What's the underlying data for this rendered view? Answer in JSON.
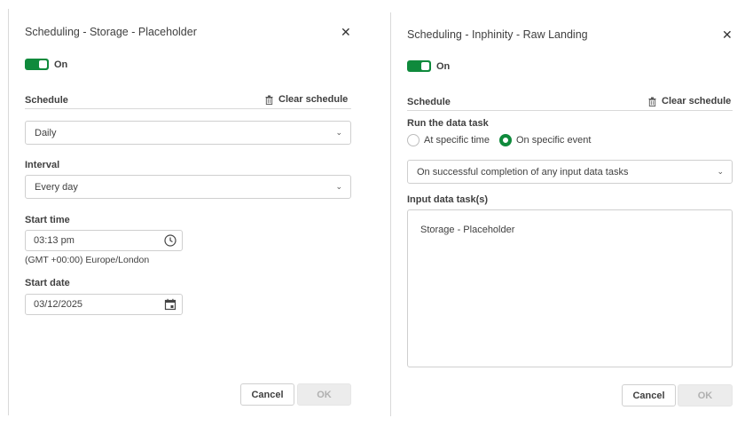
{
  "left": {
    "title": "Scheduling - Storage - Placeholder",
    "toggle_label": "On",
    "schedule_label": "Schedule",
    "clear_label": "Clear schedule",
    "frequency_value": "Daily",
    "interval_label": "Interval",
    "interval_value": "Every day",
    "start_time_label": "Start time",
    "start_time_value": "03:13 pm",
    "timezone": "(GMT +00:00) Europe/London",
    "start_date_label": "Start date",
    "start_date_value": "03/12/2025",
    "cancel_label": "Cancel",
    "ok_label": "OK"
  },
  "right": {
    "title": "Scheduling - Inphinity - Raw Landing",
    "toggle_label": "On",
    "schedule_label": "Schedule",
    "clear_label": "Clear schedule",
    "run_label": "Run the data task",
    "radio_time_label": "At specific time",
    "radio_event_label": "On specific event",
    "event_value": "On successful completion of any input data tasks",
    "input_tasks_label": "Input data task(s)",
    "input_task_item": "Storage - Placeholder",
    "cancel_label": "Cancel",
    "ok_label": "OK"
  },
  "colors": {
    "accent": "#0f8a3c",
    "border": "#cfcfcf",
    "disabled": "#ececec"
  }
}
